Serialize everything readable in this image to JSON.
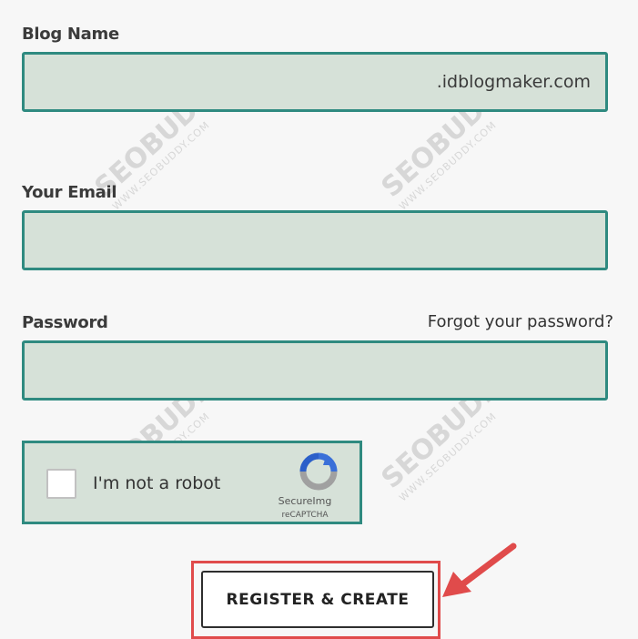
{
  "form": {
    "blog_name_label": "Blog Name",
    "blog_name_value": "",
    "blog_name_suffix": ".idblogmaker.com",
    "email_label": "Your Email",
    "email_value": "",
    "password_label": "Password",
    "password_value": "",
    "forgot_link": "Forgot your password?",
    "submit_label": "REGISTER & CREATE"
  },
  "captcha": {
    "label": "I'm not a robot",
    "brand": "SecureImg",
    "sub_brand": "reCAPTCHA",
    "checked": false
  },
  "watermarks": [
    {
      "text": "SEOBUDDY",
      "sub": "WWW.SEOBUDDY.COM"
    },
    {
      "text": "SEOBUDDY",
      "sub": "WWW.SEOBUDDY.COM"
    },
    {
      "text": "SEOBUDDY",
      "sub": "WWW.SEOBUDDY.COM"
    },
    {
      "text": "SEOBUDDY",
      "sub": "WWW.SEOBUDDY.COM"
    }
  ],
  "colors": {
    "field_bg": "#d6e1d8",
    "field_border": "#2f8a80",
    "highlight": "#e04b4b"
  }
}
